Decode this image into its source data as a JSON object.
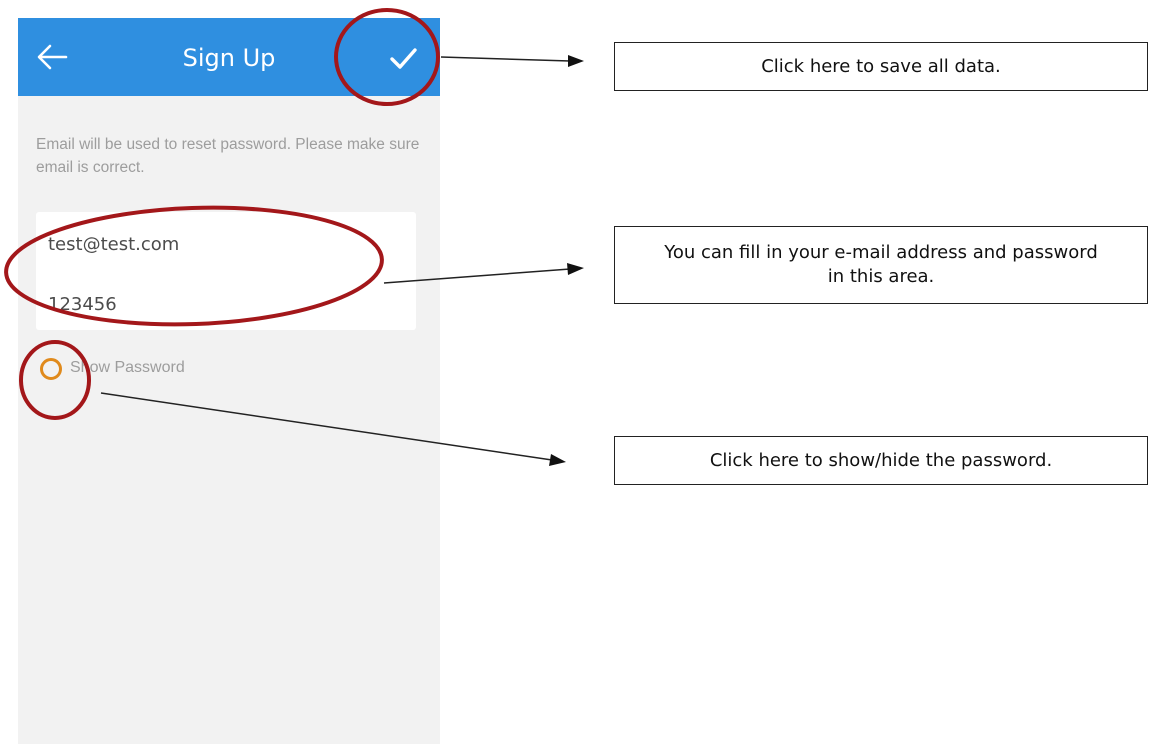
{
  "app": {
    "title": "Sign Up",
    "back_icon": "back-arrow-icon",
    "save_icon": "checkmark-icon",
    "header_color": "#2f8fe0"
  },
  "form": {
    "info_text": "Email will be used to reset password. Please make sure email is correct.",
    "email_value": "test@test.com",
    "password_value": "123456",
    "show_password_label": "Show Password",
    "show_password_checked": false
  },
  "annotations": {
    "highlight_color": "#a3171a",
    "callouts": [
      {
        "text": "Click here to save all data."
      },
      {
        "text": "You can fill in your e-mail address and password in this area."
      },
      {
        "text": "Click here to show/hide the password."
      }
    ]
  }
}
